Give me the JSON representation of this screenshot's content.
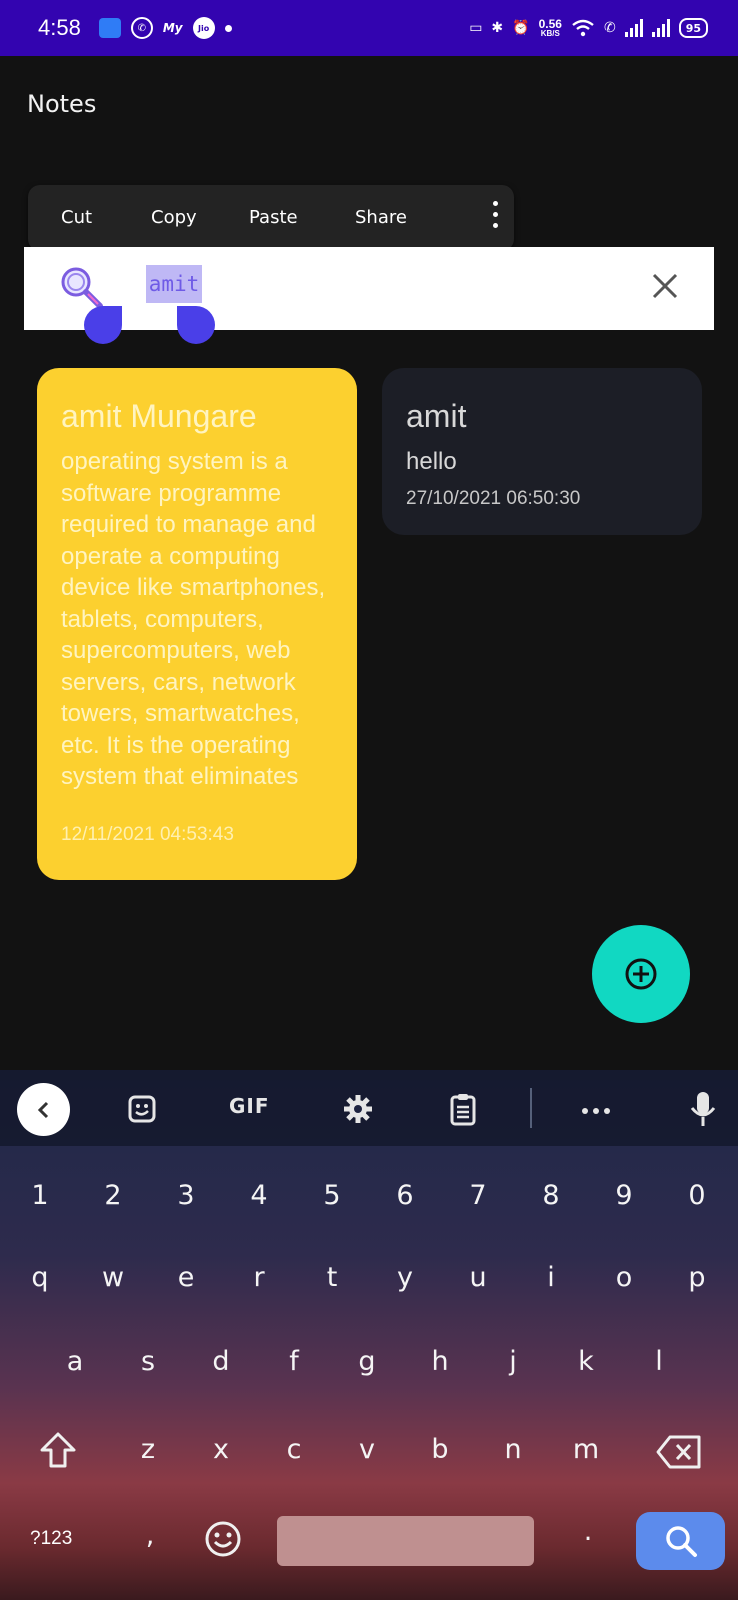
{
  "status_bar": {
    "time": "4:58",
    "net_speed_value": "0.56",
    "net_speed_unit": "KB/S",
    "battery": "95",
    "jio_label": "Jio",
    "app_icon_text": "My"
  },
  "app": {
    "title": "Notes"
  },
  "context_menu": {
    "cut": "Cut",
    "copy": "Copy",
    "paste": "Paste",
    "share": "Share"
  },
  "search": {
    "value": "amit"
  },
  "notes": [
    {
      "title": "amit Mungare",
      "body": " operating system is a software programme required to manage and operate a computing device like smartphones, tablets, computers, supercomputers, web servers, cars, network towers, smartwatches, etc. It is the operating system that eliminates",
      "date": "12/11/2021 04:53:43",
      "color": "#fcd02f"
    },
    {
      "title": "amit",
      "body": "hello",
      "date": "27/10/2021 06:50:30",
      "color": "#1c1e26"
    }
  ],
  "fab_color": "#11d8c2",
  "keyboard": {
    "gif_label": "GIF",
    "numbers": [
      "1",
      "2",
      "3",
      "4",
      "5",
      "6",
      "7",
      "8",
      "9",
      "0"
    ],
    "row1": [
      "q",
      "w",
      "e",
      "r",
      "t",
      "y",
      "u",
      "i",
      "o",
      "p"
    ],
    "row2": [
      "a",
      "s",
      "d",
      "f",
      "g",
      "h",
      "j",
      "k",
      "l"
    ],
    "row3": [
      "z",
      "x",
      "c",
      "v",
      "b",
      "n",
      "m"
    ],
    "symbols_key": "?123",
    "comma": ",",
    "period": "."
  }
}
